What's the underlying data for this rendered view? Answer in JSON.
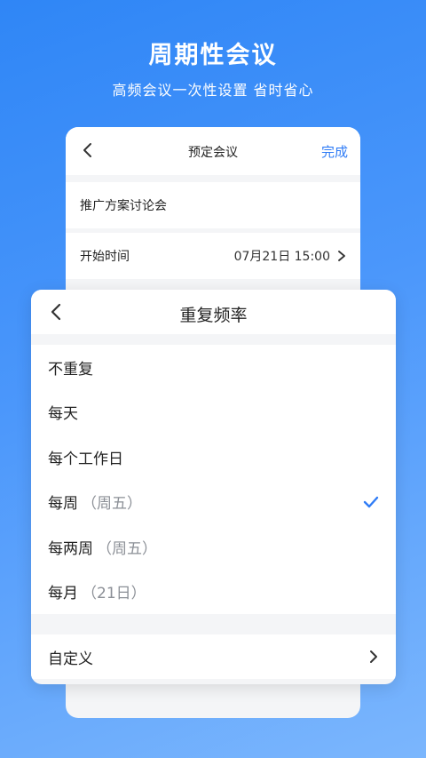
{
  "hero": {
    "title": "周期性会议",
    "subtitle": "高频会议一次性设置 省时省心"
  },
  "background_screen": {
    "back_icon": "chevron-left-icon",
    "title": "预定会议",
    "done_label": "完成",
    "meeting_name": "推广方案讨论会",
    "start_time_label": "开始时间",
    "start_time_value": "07月21日 15:00"
  },
  "sheet": {
    "title": "重复频率",
    "options": [
      {
        "label": "不重复",
        "hint": ""
      },
      {
        "label": "每天",
        "hint": ""
      },
      {
        "label": "每个工作日",
        "hint": ""
      },
      {
        "label": "每周",
        "hint": "（周五）",
        "selected": true
      },
      {
        "label": "每两周",
        "hint": "（周五）"
      },
      {
        "label": "每月",
        "hint": "（21日）"
      }
    ],
    "custom_label": "自定义"
  },
  "colors": {
    "accent": "#2f7cf6",
    "background_top": "#2f86f6",
    "background_bottom": "#7bb6fd"
  }
}
